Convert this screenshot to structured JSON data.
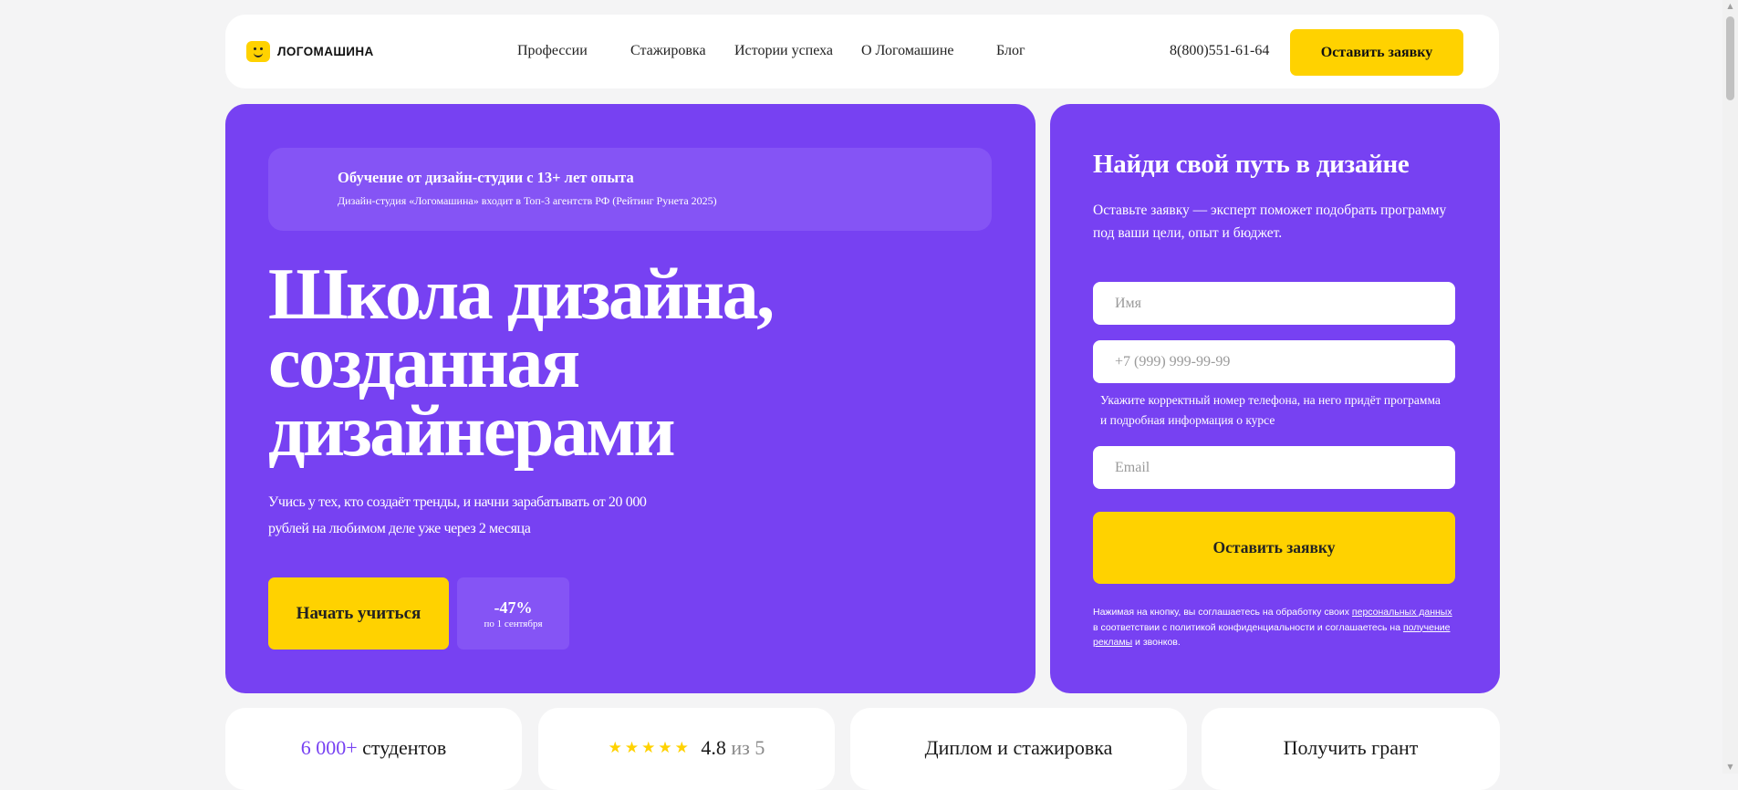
{
  "header": {
    "logo_text": "ЛОГОМАШИНА",
    "nav": [
      {
        "label": "Профессии"
      },
      {
        "label": "Стажировка"
      },
      {
        "label": "Истории успеха"
      },
      {
        "label": "О Логомашине"
      },
      {
        "label": "Блог"
      }
    ],
    "phone": "8(800)551-61-64",
    "cta_label": "Оставить заявку"
  },
  "hero": {
    "banner_title": "Обучение от дизайн-студии с 13+ лет опыта",
    "banner_subtitle": "Дизайн-студия «Логомашина» входит в Топ-3 агентств РФ (Рейтинг Рунета 2025)",
    "title_lines": [
      "Школа дизайна,",
      "созданная",
      "дизайнерами"
    ],
    "description": "Учись у тех, кто создаёт тренды, и начни зарабатывать от 20 000 рублей на любимом деле уже через 2 месяца",
    "start_label": "Начать учиться",
    "discount_value": "-47%",
    "discount_note": "по 1 сентября"
  },
  "form": {
    "title": "Найди свой путь в дизайне",
    "description": "Оставьте заявку — эксперт поможет подобрать программу под ваши цели, опыт и бюджет.",
    "name_placeholder": "Имя",
    "phone_placeholder": "+7 (999) 999-99-99",
    "phone_hint": "Укажите корректный номер телефона, на него придёт программа и подробная информация о курсе",
    "email_placeholder": "Email",
    "submit_label": "Оставить заявку",
    "consent_part1": "Нажимая на кнопку, вы соглашаетесь на обработку своих",
    "consent_link1": "персональных данных",
    "consent_part2": "в соответствии с политикой конфиденциальности и соглашаетесь на",
    "consent_link2": "получение рекламы",
    "consent_part3": "и звонков."
  },
  "stats": {
    "students_value": "6 000+",
    "students_label": "студентов",
    "rating_value": "4.8",
    "rating_suffix": "из 5",
    "rating_stars": 5,
    "diploma_label": "Диплом и стажировка",
    "grant_label": "Получить грант"
  },
  "colors": {
    "brand_purple": "#7741f2",
    "accent_yellow": "#ffd200",
    "background": "#f4f4f5"
  }
}
